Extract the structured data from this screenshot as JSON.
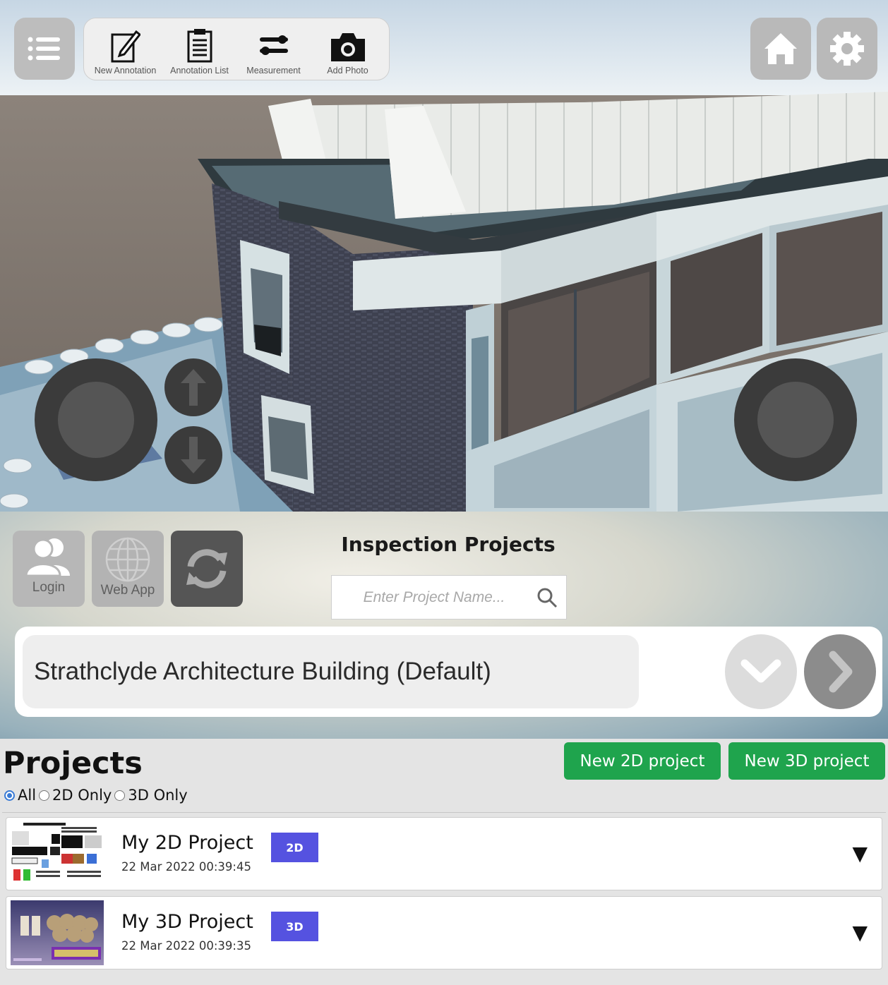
{
  "toolbar": {
    "items": [
      {
        "label": "New Annotation",
        "icon": "edit-icon"
      },
      {
        "label": "Annotation List",
        "icon": "clipboard-icon"
      },
      {
        "label": "Measurement",
        "icon": "sliders-icon"
      },
      {
        "label": "Add Photo",
        "icon": "camera-icon"
      }
    ],
    "menu_icon": "list-icon",
    "home_icon": "home-icon",
    "settings_icon": "gear-icon"
  },
  "controls": {
    "left_joystick": "joystick",
    "right_joystick": "joystick",
    "up_icon": "arrow-up-icon",
    "down_icon": "arrow-down-icon"
  },
  "inspection": {
    "title": "Inspection Projects",
    "login_label": "Login",
    "webapp_label": "Web App",
    "search_placeholder": "Enter Project Name...",
    "selected_project": "Strathclyde Architecture Building (Default)"
  },
  "projects": {
    "title": "Projects",
    "new_2d_label": "New 2D project",
    "new_3d_label": "New 3D project",
    "filters": [
      {
        "label": "All",
        "checked": true
      },
      {
        "label": "2D Only",
        "checked": false
      },
      {
        "label": "3D Only",
        "checked": false
      }
    ],
    "rows": [
      {
        "name": "My 2D Project",
        "date": "22 Mar 2022 00:39:45",
        "badge": "2D",
        "toggle": "▼"
      },
      {
        "name": "My 3D Project",
        "date": "22 Mar 2022 00:39:35",
        "badge": "3D",
        "toggle": "▼"
      }
    ]
  },
  "colors": {
    "green": "#1fa44d",
    "badge": "#5552e0",
    "radio": "#3a7bd5"
  }
}
